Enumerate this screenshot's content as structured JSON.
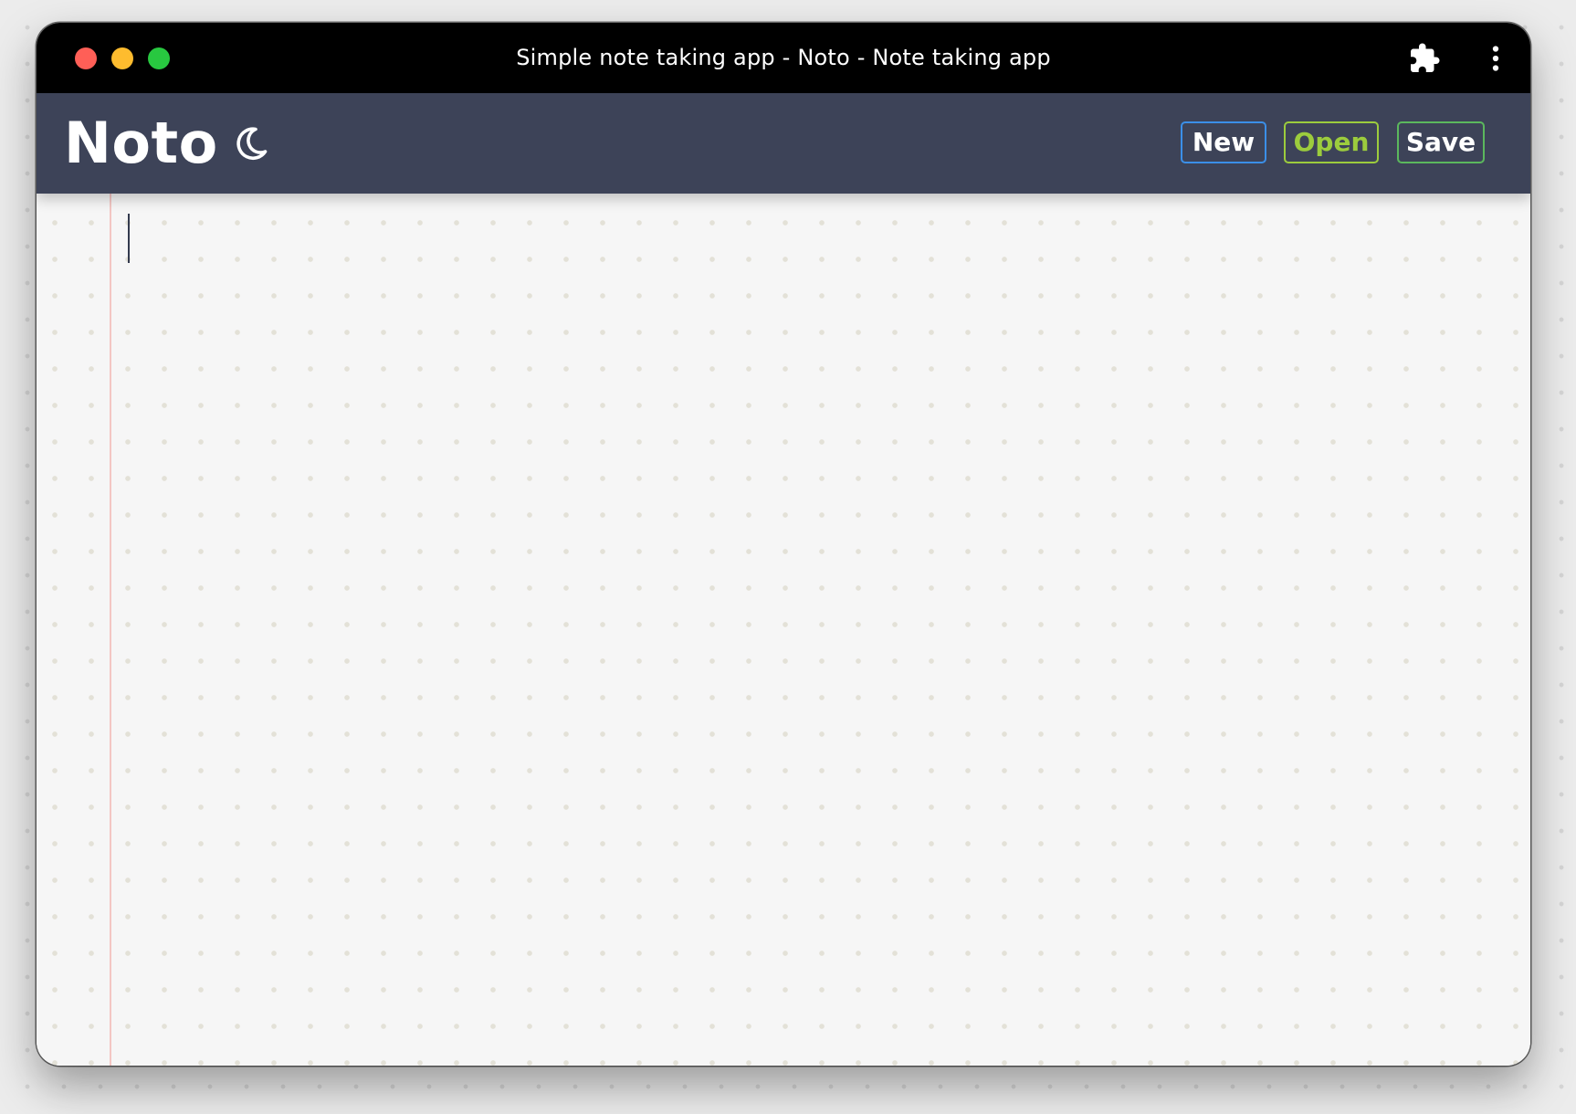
{
  "window": {
    "title": "Simple note taking app - Noto - Note taking app",
    "controls": [
      "close",
      "minimize",
      "maximize"
    ],
    "toolbar_icons": [
      "puzzle-extension-icon",
      "more-vertical-icon"
    ]
  },
  "header": {
    "brand": "Noto",
    "theme_toggle_icon": "moon-icon",
    "buttons": {
      "new": "New",
      "open": "Open",
      "save": "Save"
    }
  },
  "editor": {
    "content": ""
  },
  "colors": {
    "titlebar": "#000000",
    "header_bg": "#3d4358",
    "editor_bg": "#f6f6f6",
    "margin_line": "#f3c6c3",
    "new_border": "#3b8fe8",
    "open_accent": "#9ccc3d",
    "save_border": "#5bb85d",
    "traffic_close": "#ff5f57",
    "traffic_minimize": "#febc2e",
    "traffic_maximize": "#28c840"
  }
}
